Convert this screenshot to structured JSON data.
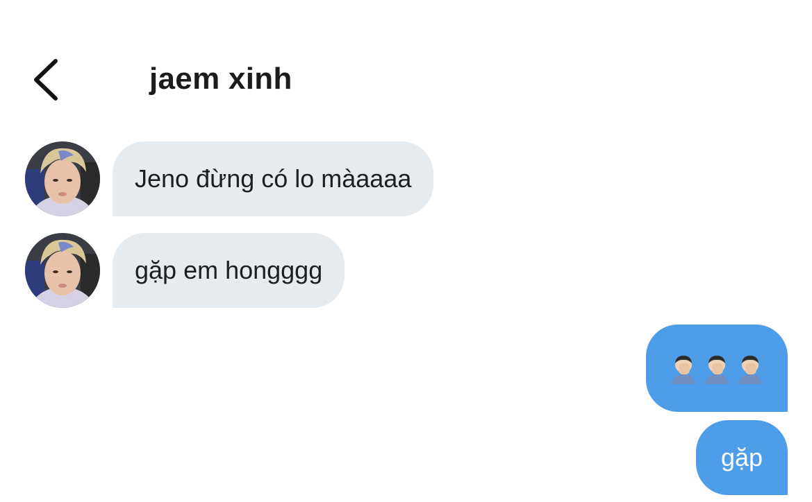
{
  "header": {
    "title": "jaem xinh",
    "back_icon": "chevron-left-icon"
  },
  "messages": [
    {
      "direction": "incoming",
      "text": "Jeno đừng có lo màaaaa"
    },
    {
      "direction": "incoming",
      "text": "gặp em hongggg"
    },
    {
      "direction": "outgoing",
      "emoji": [
        "man-facepalming-emoji",
        "man-facepalming-emoji",
        "man-facepalming-emoji"
      ]
    },
    {
      "direction": "outgoing",
      "text": "gặp"
    }
  ],
  "colors": {
    "incoming_bubble": "#e6ebef",
    "outgoing_bubble": "#4e9de8",
    "title_text": "#1c1c1c"
  }
}
